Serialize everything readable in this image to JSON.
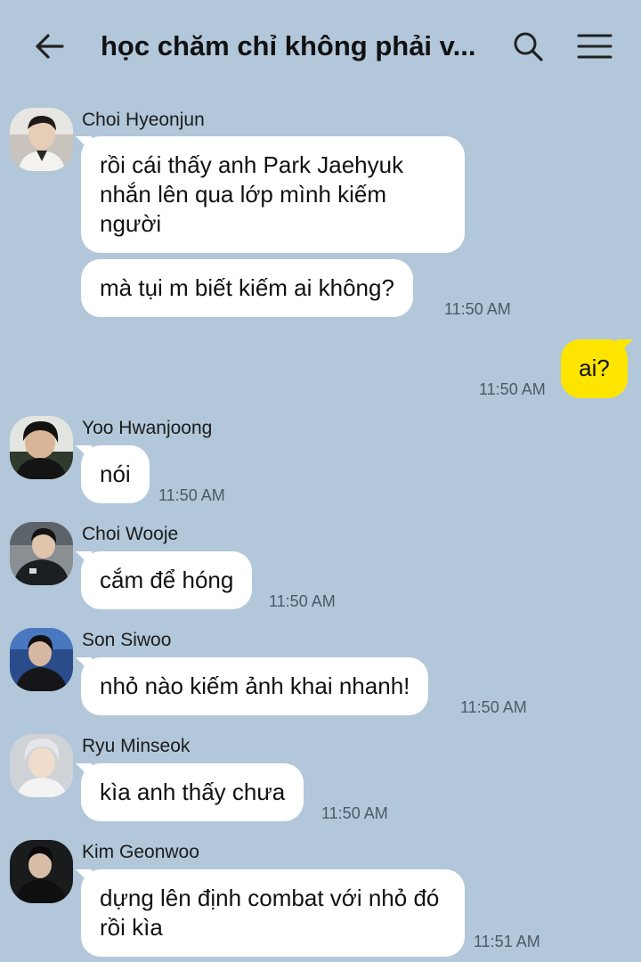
{
  "header": {
    "title": "học chăm chỉ không phải v...",
    "back_icon": "back-arrow-icon",
    "search_icon": "search-icon",
    "menu_icon": "menu-icon"
  },
  "colors": {
    "background": "#b2c7da",
    "incoming_bubble": "#ffffff",
    "outgoing_bubble": "#fee500"
  },
  "messages": [
    {
      "sender": "Choi Hyeonjun",
      "bubbles": [
        "rồi cái thấy anh Park Jaehyuk nhắn lên qua lớp mình kiếm người",
        "mà tụi m biết kiếm ai không?"
      ],
      "time": "11:50 AM"
    },
    {
      "sender": "me",
      "bubbles": [
        "ai?"
      ],
      "time": "11:50 AM"
    },
    {
      "sender": "Yoo Hwanjoong",
      "bubbles": [
        "nói"
      ],
      "time": "11:50 AM"
    },
    {
      "sender": "Choi Wooje",
      "bubbles": [
        "cắm để hóng"
      ],
      "time": "11:50 AM"
    },
    {
      "sender": "Son Siwoo",
      "bubbles": [
        "nhỏ nào kiếm ảnh khai nhanh!"
      ],
      "time": "11:50 AM"
    },
    {
      "sender": "Ryu Minseok",
      "bubbles": [
        "kìa anh thấy chưa"
      ],
      "time": "11:50 AM"
    },
    {
      "sender": "Kim Geonwoo",
      "bubbles": [
        "dựng lên định combat với nhỏ đó rồi kìa"
      ],
      "time": "11:51 AM"
    }
  ]
}
